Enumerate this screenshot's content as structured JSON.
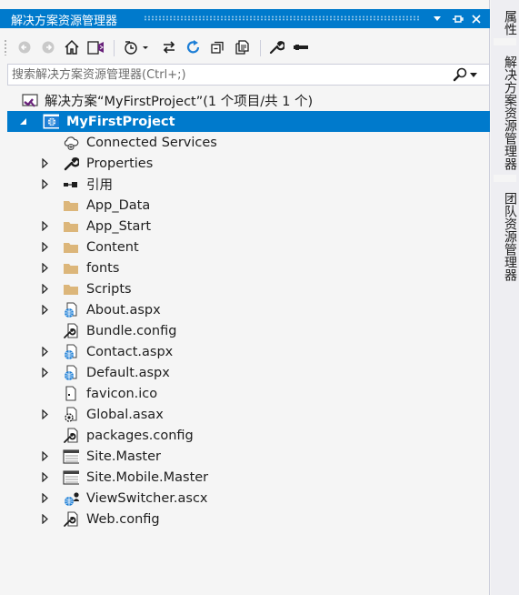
{
  "window": {
    "title": "解决方案资源管理器"
  },
  "search": {
    "placeholder": "搜索解决方案资源管理器(Ctrl+;)"
  },
  "solution": {
    "label": "解决方案“MyFirstProject”(1 个项目/共 1 个)"
  },
  "project": {
    "label": "MyFirstProject"
  },
  "tree_items": [
    {
      "label": "Connected Services",
      "icon": "cloud-icon",
      "expandable": false
    },
    {
      "label": "Properties",
      "icon": "wrench-icon",
      "expandable": true
    },
    {
      "label": "引用",
      "icon": "reference-icon",
      "expandable": true
    },
    {
      "label": "App_Data",
      "icon": "folder-icon",
      "expandable": false
    },
    {
      "label": "App_Start",
      "icon": "folder-icon",
      "expandable": true
    },
    {
      "label": "Content",
      "icon": "folder-icon",
      "expandable": true
    },
    {
      "label": "fonts",
      "icon": "folder-icon",
      "expandable": true
    },
    {
      "label": "Scripts",
      "icon": "folder-icon",
      "expandable": true
    },
    {
      "label": "About.aspx",
      "icon": "web-page-icon",
      "expandable": true
    },
    {
      "label": "Bundle.config",
      "icon": "config-file-icon",
      "expandable": false
    },
    {
      "label": "Contact.aspx",
      "icon": "web-page-icon",
      "expandable": true
    },
    {
      "label": "Default.aspx",
      "icon": "web-page-icon",
      "expandable": true
    },
    {
      "label": "favicon.ico",
      "icon": "ico-file-icon",
      "expandable": false
    },
    {
      "label": "Global.asax",
      "icon": "global-asax-icon",
      "expandable": true
    },
    {
      "label": "packages.config",
      "icon": "config-file-icon",
      "expandable": false
    },
    {
      "label": "Site.Master",
      "icon": "master-page-icon",
      "expandable": true
    },
    {
      "label": "Site.Mobile.Master",
      "icon": "master-page-icon",
      "expandable": true
    },
    {
      "label": "ViewSwitcher.ascx",
      "icon": "user-control-icon",
      "expandable": true
    },
    {
      "label": "Web.config",
      "icon": "config-file-icon",
      "expandable": true
    }
  ],
  "side_tabs": {
    "properties": "属性",
    "solution_explorer": "解决方案资源管理器",
    "team_explorer": "团队资源管理器"
  },
  "colors": {
    "accent": "#007acc",
    "background": "#f5f5f5",
    "folder": "#dcb67a",
    "web_icon": "#1e7fd6"
  }
}
